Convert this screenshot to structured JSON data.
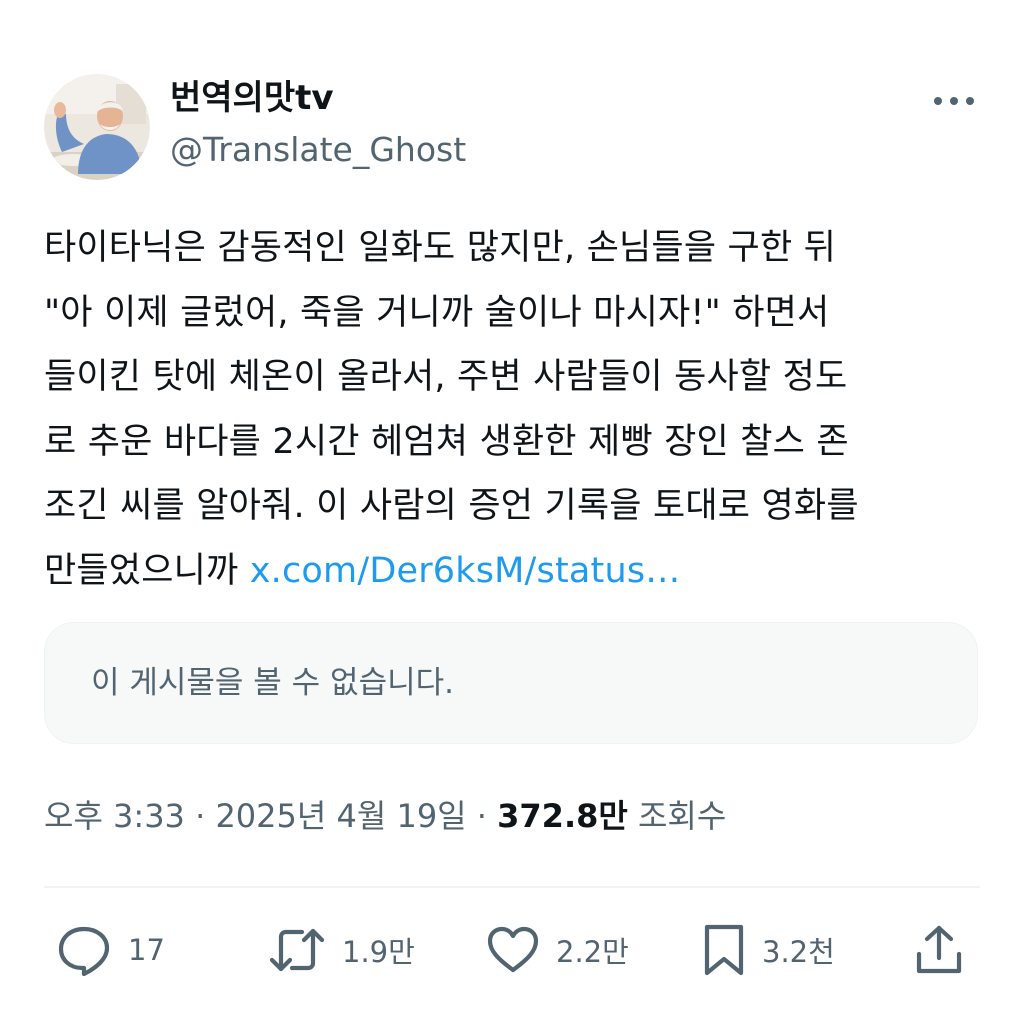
{
  "author": {
    "display_name": "번역의맛tv",
    "handle": "@Translate_Ghost"
  },
  "tweet": {
    "lines": [
      "타이타닉은 감동적인 일화도 많지만, 손님들을 구한 뒤",
      "\"아 이제 글렀어, 죽을 거니까 술이나 마시자!\" 하면서",
      "들이킨 탓에 체온이 올라서, 주변 사람들이 동사할 정도",
      "로 추운 바다를 2시간 헤엄쳐 생환한 제빵 장인 찰스 존",
      "조긴 씨를 알아줘. 이 사람의 증언 기록을 토대로 영화를",
      "만들었으니까 "
    ],
    "link_text": "x.com/Der6ksM/status…"
  },
  "quoted_post": {
    "unavailable_text": "이 게시물을 볼 수 없습니다."
  },
  "meta": {
    "time": "오후 3:33",
    "separator": " · ",
    "date": "2025년 4월 19일",
    "views_count": "372.8만",
    "views_label": " 조회수"
  },
  "actions": {
    "replies": "17",
    "retweets": "1.9만",
    "likes": "2.2만",
    "bookmarks": "3.2천"
  },
  "icons": {
    "more": "more-horizontal-icon",
    "reply": "reply-icon",
    "retweet": "retweet-icon",
    "like": "heart-icon",
    "bookmark": "bookmark-icon",
    "share": "share-icon"
  },
  "colors": {
    "text": "#0f1419",
    "secondary": "#536471",
    "link": "#1d9bf0",
    "card_bg": "#f7f9f9",
    "divider": "#eff3f4"
  }
}
